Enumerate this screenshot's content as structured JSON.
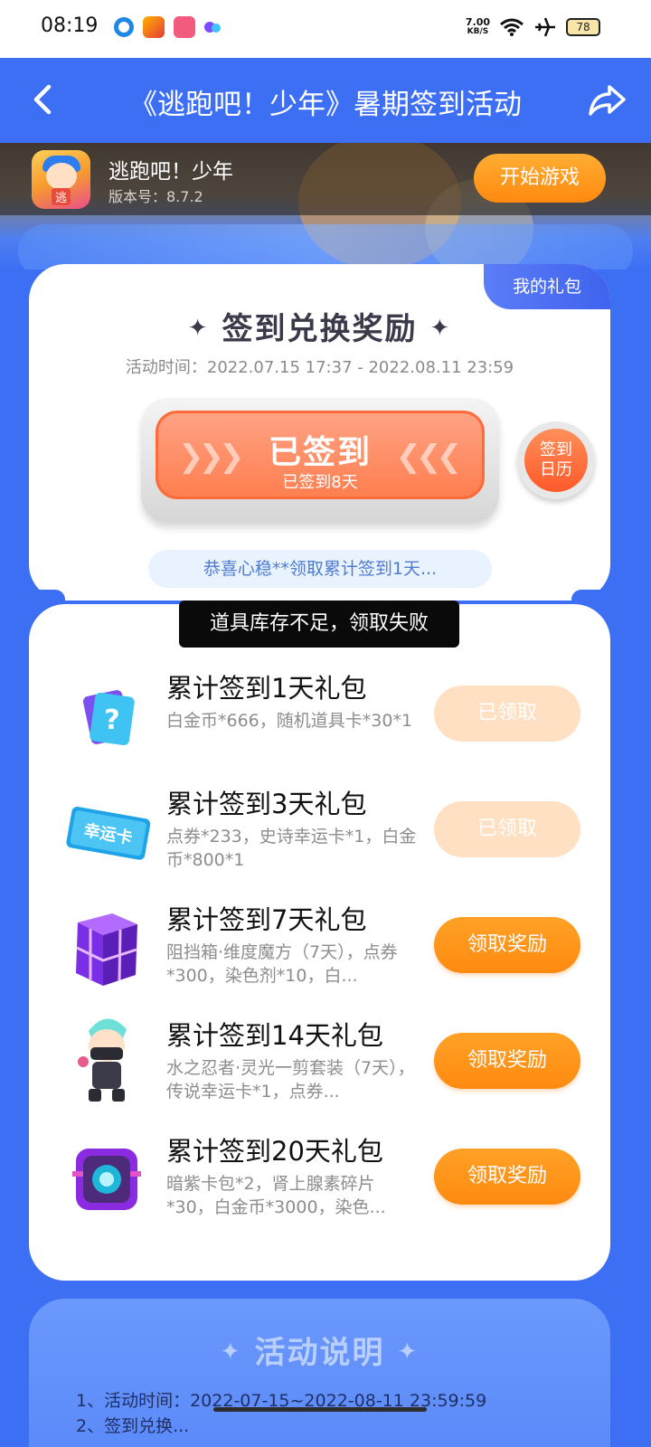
{
  "status_bar": {
    "time": "08:19",
    "net_speed_value": "7.00",
    "net_speed_unit": "KB/S",
    "battery": "78",
    "icons": [
      "app-circle-icon",
      "game-app-icon",
      "pink-app-icon",
      "dots-app-icon",
      "wifi-icon",
      "airplane-icon",
      "battery-icon"
    ]
  },
  "header": {
    "title": "《逃跑吧！少年》暑期签到活动",
    "back_icon": "back-arrow-icon",
    "share_icon": "share-icon"
  },
  "game": {
    "name": "逃跑吧！少年",
    "version": "版本号：8.7.2",
    "icon_tag": "逃",
    "start_button": "开始游戏"
  },
  "signin": {
    "my_gift_tab": "我的礼包",
    "title": "签到兑换奖励",
    "activity_time": "活动时间：2022.07.15 17:37 - 2022.08.11 23:59",
    "button_label": "已签到",
    "days_signed": "已签到8天",
    "calendar_button": "签到日历",
    "notice": "恭喜心稳**领取累计签到1天..."
  },
  "toast": "道具库存不足，领取失败",
  "gifts": [
    {
      "title": "累计签到1天礼包",
      "desc": "白金币*666，随机道具卡*30*1",
      "button": "已领取",
      "claimed": true,
      "icon": "question-card-icon"
    },
    {
      "title": "累计签到3天礼包",
      "desc": "点券*233，史诗幸运卡*1，白金币*800*1",
      "button": "已领取",
      "claimed": true,
      "icon": "lucky-card-icon"
    },
    {
      "title": "累计签到7天礼包",
      "desc": "阻挡箱·维度魔方（7天），点券*300，染色剂*10，白...",
      "button": "领取奖励",
      "claimed": false,
      "icon": "purple-cube-icon"
    },
    {
      "title": "累计签到14天礼包",
      "desc": "水之忍者·灵光一剪套装（7天），传说幸运卡*1，点券...",
      "button": "领取奖励",
      "claimed": false,
      "icon": "ninja-character-icon"
    },
    {
      "title": "累计签到20天礼包",
      "desc": "暗紫卡包*2，肾上腺素碎片*30，白金币*3000，染色...",
      "button": "领取奖励",
      "claimed": false,
      "icon": "purple-card-pack-icon"
    }
  ],
  "gift_icon_text": {
    "lucky_card": "幸运卡",
    "question": "?"
  },
  "description": {
    "title": "活动说明",
    "line1": "1、活动时间：2022-07-15~2022-08-11 23:59:59",
    "line2": "2、签到兑换..."
  },
  "colors": {
    "primary_blue": "#3d6ff5",
    "orange": "#ff8a10",
    "claimed": "#ffe0c2",
    "sign_orange": "#ff7f50"
  }
}
